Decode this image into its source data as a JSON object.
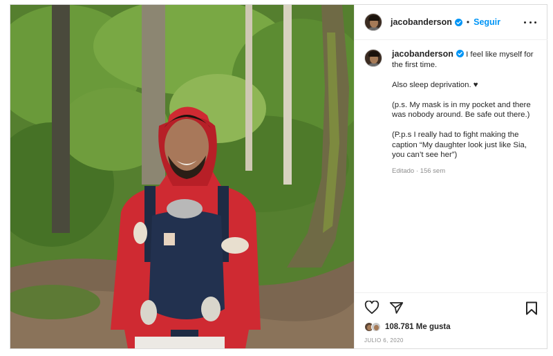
{
  "post": {
    "username": "jacobanderson",
    "follow_label": "Seguir",
    "separator": "•",
    "caption_lines": [
      "I feel like myself for the first time.",
      "Also sleep deprivation. ♥",
      "(p.s. My mask is in my pocket and there was nobody around. Be safe out there.)",
      "(P.p.s I really had to fight making the caption “My daughter look just like Sia, you can’t see her”)"
    ],
    "edited_label": "Editado",
    "meta_separator": "·",
    "age": "156 sem",
    "likes_count": "108.781",
    "likes_label": "Me gusta",
    "date": "JULIO 6, 2020"
  },
  "icons": {
    "verified": "verified-badge-icon",
    "more": "more-options-icon",
    "like": "heart-icon",
    "share": "paper-plane-icon",
    "save": "bookmark-icon"
  },
  "colors": {
    "accent": "#0095f6",
    "text": "#262626",
    "muted": "#8e8e8e",
    "border": "#dbdbdb"
  }
}
